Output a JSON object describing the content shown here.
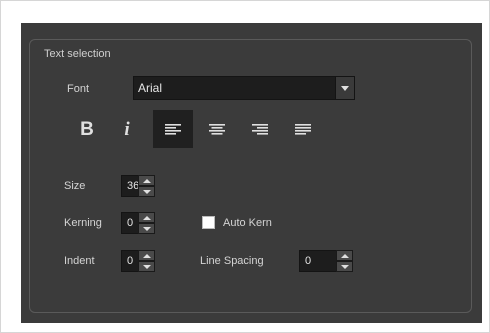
{
  "group": {
    "title": "Text selection"
  },
  "font": {
    "label": "Font",
    "value": "Arial"
  },
  "style_buttons": {
    "bold": "B",
    "italic": "i",
    "active": "align-left"
  },
  "size": {
    "label": "Size",
    "value": "36"
  },
  "kerning": {
    "label": "Kerning",
    "value": "0"
  },
  "auto_kern": {
    "label": "Auto Kern",
    "checked": false
  },
  "indent": {
    "label": "Indent",
    "value": "0"
  },
  "line_spacing": {
    "label": "Line Spacing",
    "value": "0"
  }
}
